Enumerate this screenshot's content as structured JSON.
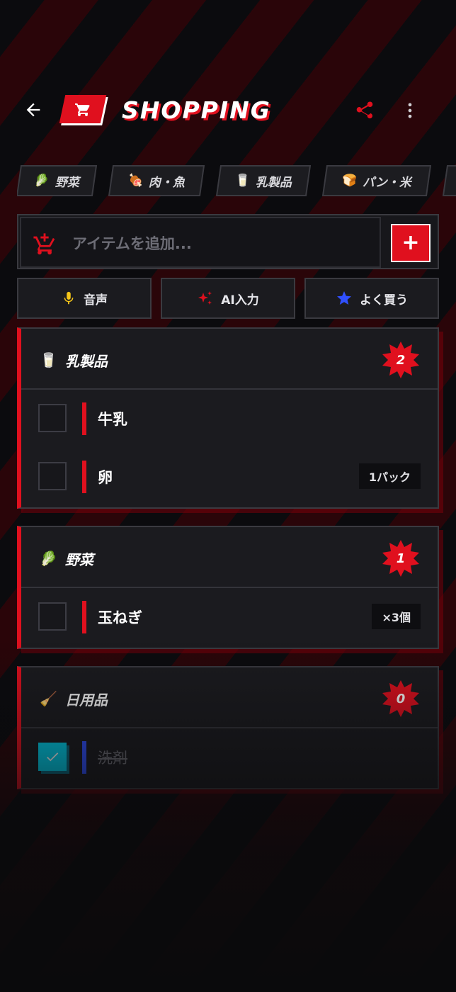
{
  "header": {
    "title": "SHOPPING",
    "back_icon": "arrow-left-icon",
    "logo_icon": "cart-icon",
    "share_icon": "share-icon",
    "more_icon": "more-vertical-icon",
    "accent": "#e0101e"
  },
  "chips": [
    {
      "emoji": "🥬",
      "label": "野菜"
    },
    {
      "emoji": "🍖",
      "label": "肉・魚"
    },
    {
      "emoji": "🥛",
      "label": "乳製品"
    },
    {
      "emoji": "🍞",
      "label": "パン・米"
    }
  ],
  "add": {
    "placeholder": "アイテムを追加...",
    "button_label": "+"
  },
  "actions": [
    {
      "label": "音声",
      "icon": "mic-icon",
      "color": "#f5c518"
    },
    {
      "label": "AI入力",
      "icon": "sparkle-icon",
      "color": "#e0101e"
    },
    {
      "label": "よく買う",
      "icon": "star-icon",
      "color": "#3050ff"
    }
  ],
  "categories": [
    {
      "emoji": "🥛",
      "title": "乳製品",
      "count": "2",
      "items": [
        {
          "name": "牛乳",
          "qty": "",
          "checked": false
        },
        {
          "name": "卵",
          "qty": "1パック",
          "checked": false
        }
      ]
    },
    {
      "emoji": "🥬",
      "title": "野菜",
      "count": "1",
      "items": [
        {
          "name": "玉ねぎ",
          "qty": "×3個",
          "checked": false
        }
      ]
    },
    {
      "emoji": "🧹",
      "title": "日用品",
      "count": "0",
      "items": [
        {
          "name": "洗剤",
          "qty": "",
          "checked": true
        }
      ]
    }
  ]
}
